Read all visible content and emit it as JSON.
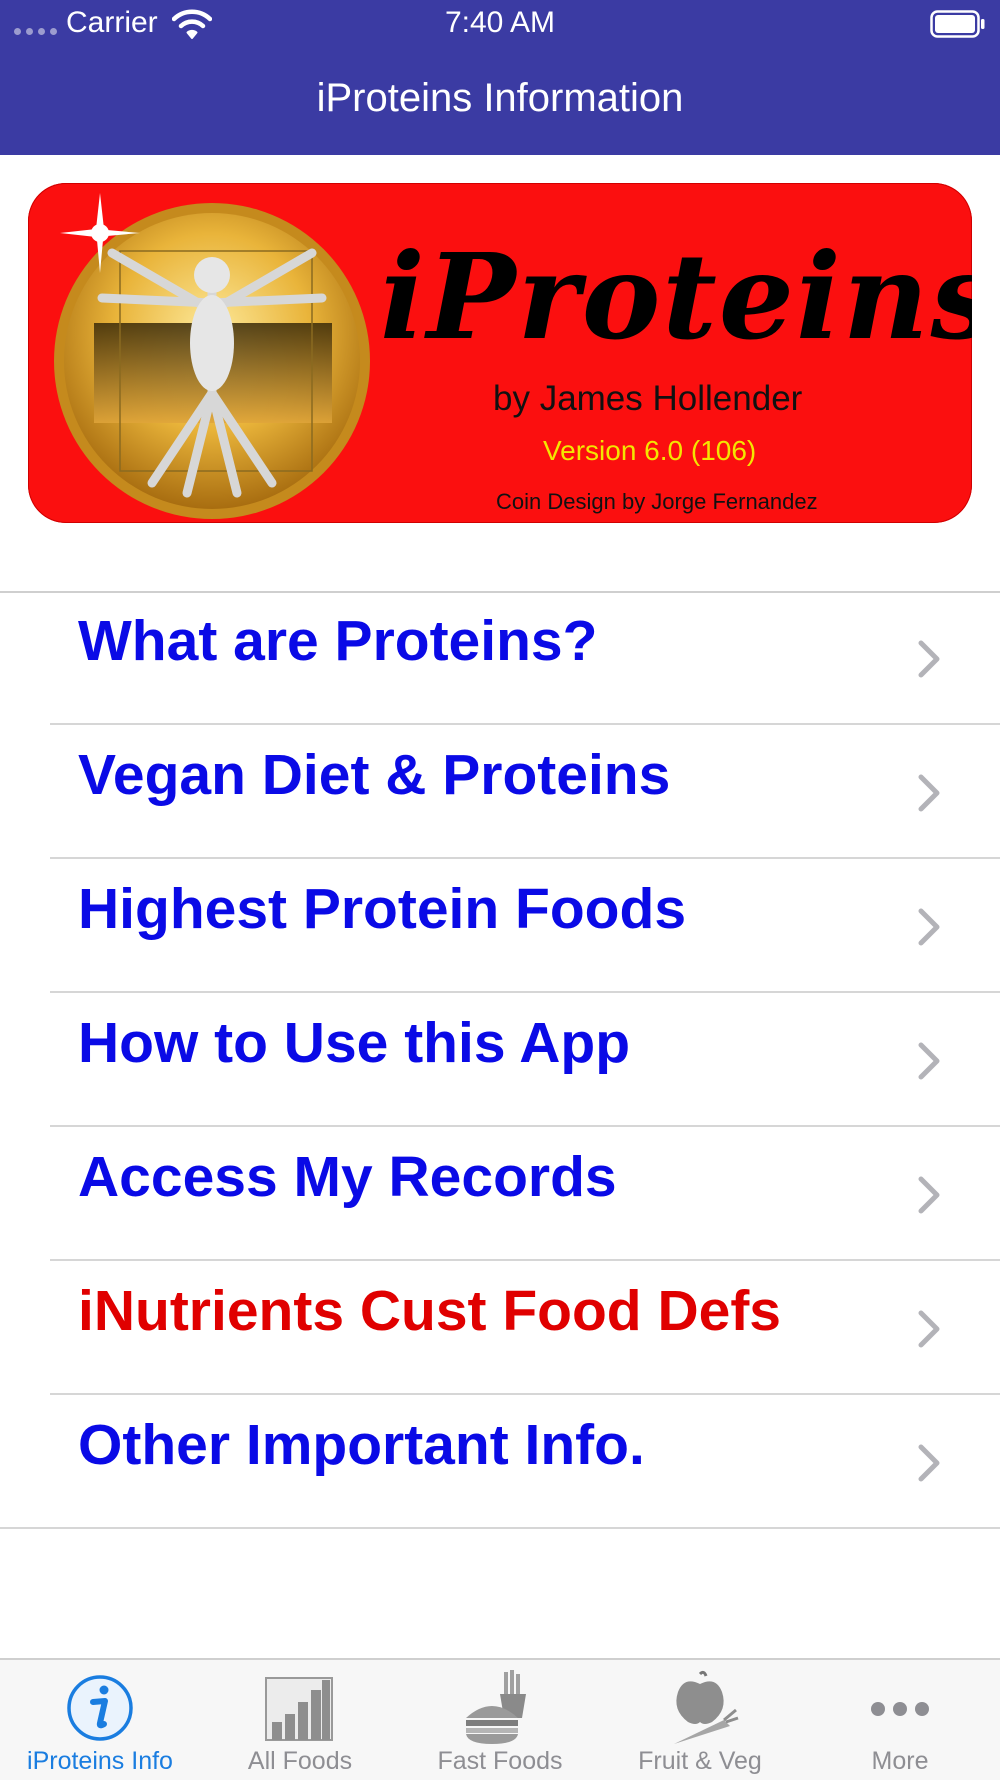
{
  "status_bar": {
    "carrier": "Carrier",
    "time": "7:40 AM"
  },
  "nav": {
    "title": "iProteins Information"
  },
  "banner": {
    "brand": "iProteins",
    "byline": "by James Hollender",
    "version": "Version 6.0 (106)",
    "coin_credit": "Coin Design by Jorge Fernandez"
  },
  "menu": [
    {
      "label": "What are Proteins?",
      "color": "#0a0ae6"
    },
    {
      "label": "Vegan Diet & Proteins",
      "color": "#0a0ae6"
    },
    {
      "label": "Highest Protein Foods",
      "color": "#0a0ae6"
    },
    {
      "label": "How to Use this App",
      "color": "#0a0ae6"
    },
    {
      "label": "Access My Records",
      "color": "#0a0ae6"
    },
    {
      "label": "iNutrients Cust Food Defs",
      "color": "#e00000"
    },
    {
      "label": "Other Important Info.",
      "color": "#0a0ae6"
    }
  ],
  "tabs": [
    {
      "label": "iProteins Info",
      "icon": "info-icon",
      "active": true
    },
    {
      "label": "All Foods",
      "icon": "bar-chart-icon",
      "active": false
    },
    {
      "label": "Fast Foods",
      "icon": "burger-fries-icon",
      "active": false
    },
    {
      "label": "Fruit & Veg",
      "icon": "apple-carrot-icon",
      "active": false
    },
    {
      "label": "More",
      "icon": "more-icon",
      "active": false
    }
  ],
  "colors": {
    "nav_bar": "#3b3ba3",
    "banner": "#fb0f0f",
    "tab_active": "#1a7de0",
    "tab_inactive": "#8e8e93"
  }
}
